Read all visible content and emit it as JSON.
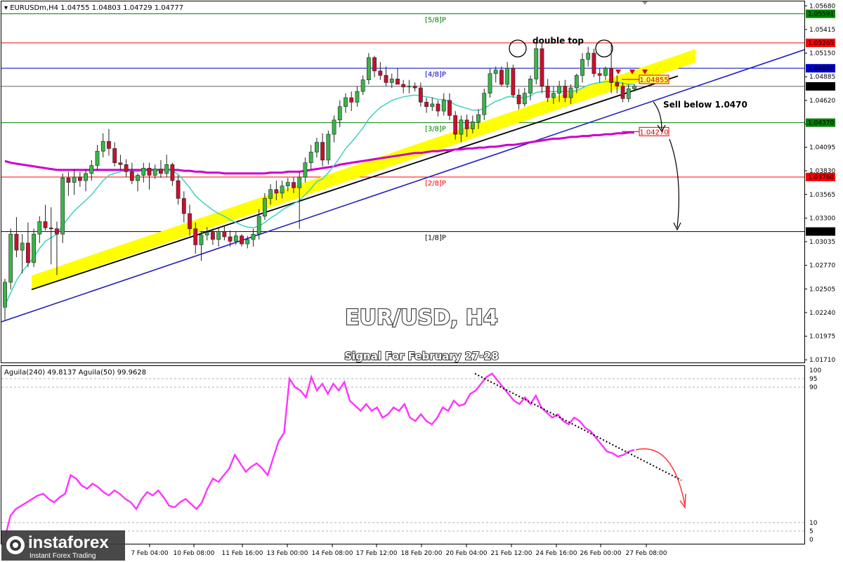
{
  "header": {
    "symbol": "EURUSDm,H4",
    "ohlc": "1.04755 1.04803 1.04729 1.04777"
  },
  "main_title": "EUR/USD, H4",
  "signal_title": "Signal For February  27-28",
  "annotations": {
    "double_top": "double top",
    "sell_below": "Sell below 1.0470"
  },
  "indicator_header": "Aguila(240) 49.8137  Aguila(50) 99.9628",
  "logo": {
    "name": "instaforex",
    "tagline": "Instant Forex Trading"
  },
  "colors": {
    "bull": "#39b54a",
    "bear": "#c8102e",
    "ema_short": "#40d0c0",
    "ema_long": "#cc00cc",
    "channel": "#ffff00",
    "trendline": "#000000",
    "blue_line": "#2020c0",
    "osc": "#ff33ff",
    "green_level": "#008000",
    "red_level": "#ff0000",
    "blue_level": "#0000cc"
  },
  "chart_data": [
    {
      "type": "candlestick",
      "title": "EUR/USD, H4",
      "price_axis_ticks": [
        "1.05680",
        "1.05415",
        "1.05150",
        "1.04885",
        "1.04620",
        "1.04355",
        "1.04095",
        "1.03830",
        "1.03565",
        "1.03300",
        "1.03035",
        "1.02770",
        "1.02505",
        "1.02240",
        "1.01975",
        "1.01710"
      ],
      "ylim": [
        1.0168,
        1.0573
      ],
      "time_labels": [
        "7 Feb 04:00",
        "10 Feb 08:00",
        "11 Feb 16:00",
        "13 Feb 00:00",
        "14 Feb 08:00",
        "17 Feb 12:00",
        "18 Feb 20:00",
        "20 Feb 04:00",
        "21 Feb 12:00",
        "24 Feb 16:00",
        "26 Feb 00:00",
        "27 Feb 08:00"
      ],
      "murrey_levels": [
        {
          "label": "[5/8]P",
          "price": 1.05591,
          "tag": "1.05591",
          "color": "#008000"
        },
        {
          "label": "",
          "price": 1.05265,
          "tag": "1.05265",
          "color": "#ff0000"
        },
        {
          "label": "[4/8]P",
          "price": 1.0498,
          "tag": "1.04980",
          "color": "#0000cc"
        },
        {
          "label": "[3/8]P",
          "price": 1.0437,
          "tag": "1.04370",
          "color": "#008000"
        },
        {
          "label": "[2/8]P",
          "price": 1.0376,
          "tag": "1.03760",
          "color": "#ff0000"
        },
        {
          "label": "[1/8]P",
          "price": 1.03149,
          "tag": "1.03149",
          "color": "#000000"
        }
      ],
      "current_price": "1.04777",
      "marked_levels": [
        {
          "price": 1.04855,
          "tag": "1.04855"
        },
        {
          "price": 1.0427,
          "tag": "1.04270"
        }
      ],
      "candles": [
        [
          1.023,
          1.0262,
          1.0216,
          1.0258
        ],
        [
          1.0258,
          1.0318,
          1.025,
          1.0312
        ],
        [
          1.0312,
          1.0331,
          1.0286,
          1.0294
        ],
        [
          1.0294,
          1.0312,
          1.0268,
          1.0302
        ],
        [
          1.0302,
          1.0325,
          1.0275,
          1.028
        ],
        [
          1.028,
          1.0318,
          1.0275,
          1.0312
        ],
        [
          1.0312,
          1.0332,
          1.0302,
          1.0326
        ],
        [
          1.0326,
          1.0345,
          1.0316,
          1.0319
        ],
        [
          1.0319,
          1.0342,
          1.0278,
          1.0318
        ],
        [
          1.0318,
          1.0326,
          1.0266,
          1.0312
        ],
        [
          1.0312,
          1.038,
          1.0302,
          1.0375
        ],
        [
          1.0375,
          1.0382,
          1.0355,
          1.037
        ],
        [
          1.037,
          1.0385,
          1.0356,
          1.0376
        ],
        [
          1.0376,
          1.0382,
          1.0365,
          1.0372
        ],
        [
          1.0372,
          1.0385,
          1.036,
          1.038
        ],
        [
          1.038,
          1.0395,
          1.0372,
          1.0389
        ],
        [
          1.0389,
          1.0412,
          1.0384,
          1.0405
        ],
        [
          1.0405,
          1.0425,
          1.0398,
          1.0416
        ],
        [
          1.0416,
          1.043,
          1.04,
          1.0408
        ],
        [
          1.0408,
          1.0415,
          1.0388,
          1.0392
        ],
        [
          1.0392,
          1.0401,
          1.0384,
          1.039
        ],
        [
          1.039,
          1.0396,
          1.0376,
          1.0382
        ],
        [
          1.0382,
          1.0392,
          1.0368,
          1.0372
        ],
        [
          1.0372,
          1.038,
          1.036,
          1.0378
        ],
        [
          1.0378,
          1.0392,
          1.037,
          1.0386
        ],
        [
          1.0386,
          1.0392,
          1.0362,
          1.0378
        ],
        [
          1.0378,
          1.039,
          1.0374,
          1.0385
        ],
        [
          1.0385,
          1.0395,
          1.0375,
          1.038
        ],
        [
          1.038,
          1.0401,
          1.0376,
          1.039
        ],
        [
          1.039,
          1.0392,
          1.0366,
          1.0372
        ],
        [
          1.0372,
          1.0378,
          1.0345,
          1.0352
        ],
        [
          1.0352,
          1.036,
          1.0325,
          1.0335
        ],
        [
          1.0335,
          1.0345,
          1.031,
          1.0318
        ],
        [
          1.0318,
          1.0325,
          1.029,
          1.03
        ],
        [
          1.03,
          1.0315,
          1.0282,
          1.0311
        ],
        [
          1.0311,
          1.032,
          1.0305,
          1.0314
        ],
        [
          1.0314,
          1.0318,
          1.03,
          1.0306
        ],
        [
          1.0306,
          1.032,
          1.0298,
          1.0315
        ],
        [
          1.0315,
          1.0322,
          1.0305,
          1.0309
        ],
        [
          1.0309,
          1.0316,
          1.0298,
          1.0304
        ],
        [
          1.0304,
          1.0315,
          1.03,
          1.031
        ],
        [
          1.031,
          1.0312,
          1.0298,
          1.0301
        ],
        [
          1.0301,
          1.031,
          1.0296,
          1.0306
        ],
        [
          1.0306,
          1.0318,
          1.0298,
          1.0312
        ],
        [
          1.0312,
          1.034,
          1.0306,
          1.0332
        ],
        [
          1.0332,
          1.0358,
          1.0328,
          1.0352
        ],
        [
          1.0352,
          1.0368,
          1.0345,
          1.0362
        ],
        [
          1.0362,
          1.0372,
          1.035,
          1.0358
        ],
        [
          1.0358,
          1.0372,
          1.0352,
          1.0366
        ],
        [
          1.0366,
          1.0375,
          1.036,
          1.037
        ],
        [
          1.037,
          1.0376,
          1.0358,
          1.0364
        ],
        [
          1.0364,
          1.0382,
          1.0318,
          1.0376
        ],
        [
          1.0376,
          1.0398,
          1.037,
          1.0392
        ],
        [
          1.0392,
          1.0412,
          1.0385,
          1.0404
        ],
        [
          1.0404,
          1.042,
          1.0398,
          1.0415
        ],
        [
          1.0415,
          1.0425,
          1.0388,
          1.0395
        ],
        [
          1.0395,
          1.0428,
          1.039,
          1.0424
        ],
        [
          1.0424,
          1.0445,
          1.0415,
          1.044
        ],
        [
          1.044,
          1.0462,
          1.0432,
          1.0455
        ],
        [
          1.0455,
          1.047,
          1.0448,
          1.0465
        ],
        [
          1.0465,
          1.0472,
          1.045,
          1.046
        ],
        [
          1.046,
          1.0478,
          1.0455,
          1.0472
        ],
        [
          1.0472,
          1.049,
          1.0468,
          1.0485
        ],
        [
          1.0485,
          1.0515,
          1.048,
          1.051
        ],
        [
          1.051,
          1.0512,
          1.0488,
          1.0495
        ],
        [
          1.0495,
          1.0505,
          1.0485,
          1.049
        ],
        [
          1.049,
          1.05,
          1.0478,
          1.0482
        ],
        [
          1.0482,
          1.0492,
          1.0476,
          1.0486
        ],
        [
          1.0486,
          1.0498,
          1.048,
          1.048
        ],
        [
          1.048,
          1.0485,
          1.047,
          1.0477
        ],
        [
          1.0477,
          1.0485,
          1.047,
          1.0478
        ],
        [
          1.0478,
          1.0482,
          1.0472,
          1.0476
        ],
        [
          1.0476,
          1.0482,
          1.0455,
          1.046
        ],
        [
          1.046,
          1.0465,
          1.0448,
          1.0455
        ],
        [
          1.0455,
          1.0465,
          1.045,
          1.0458
        ],
        [
          1.0458,
          1.0462,
          1.0444,
          1.045
        ],
        [
          1.045,
          1.047,
          1.0445,
          1.0462
        ],
        [
          1.0462,
          1.047,
          1.044,
          1.0445
        ],
        [
          1.0445,
          1.045,
          1.0418,
          1.0424
        ],
        [
          1.0424,
          1.0445,
          1.0415,
          1.044
        ],
        [
          1.044,
          1.0446,
          1.0421,
          1.043
        ],
        [
          1.043,
          1.0445,
          1.0425,
          1.0438
        ],
        [
          1.0438,
          1.0452,
          1.043,
          1.0446
        ],
        [
          1.0446,
          1.0475,
          1.044,
          1.047
        ],
        [
          1.047,
          1.0498,
          1.0465,
          1.0492
        ],
        [
          1.0492,
          1.05,
          1.0482,
          1.0496
        ],
        [
          1.0496,
          1.05,
          1.0478,
          1.048
        ],
        [
          1.048,
          1.0505,
          1.0476,
          1.0498
        ],
        [
          1.0498,
          1.0502,
          1.0465,
          1.0468
        ],
        [
          1.0468,
          1.0475,
          1.0452,
          1.0458
        ],
        [
          1.0458,
          1.0476,
          1.0455,
          1.047
        ],
        [
          1.047,
          1.049,
          1.0462,
          1.0486
        ],
        [
          1.0486,
          1.0528,
          1.048,
          1.052
        ],
        [
          1.052,
          1.0526,
          1.047,
          1.0478
        ],
        [
          1.0478,
          1.0486,
          1.046,
          1.0465
        ],
        [
          1.0465,
          1.0478,
          1.0458,
          1.047
        ],
        [
          1.047,
          1.0484,
          1.046,
          1.0478
        ],
        [
          1.0478,
          1.0485,
          1.046,
          1.0465
        ],
        [
          1.0465,
          1.048,
          1.0458,
          1.0476
        ],
        [
          1.0476,
          1.0492,
          1.047,
          1.049
        ],
        [
          1.049,
          1.0515,
          1.0482,
          1.0508
        ],
        [
          1.0508,
          1.0522,
          1.05,
          1.0515
        ],
        [
          1.0515,
          1.052,
          1.0488,
          1.0492
        ],
        [
          1.0492,
          1.0498,
          1.0482,
          1.049
        ],
        [
          1.049,
          1.05,
          1.0485,
          1.0498
        ],
        [
          1.0498,
          1.0525,
          1.047,
          1.0482
        ],
        [
          1.0482,
          1.049,
          1.047,
          1.0478
        ],
        [
          1.0478,
          1.0482,
          1.046,
          1.0464
        ],
        [
          1.0464,
          1.048,
          1.046,
          1.0475
        ],
        [
          1.0475,
          1.048,
          1.0472,
          1.0478
        ]
      ],
      "ema_short_values": [
        1.0232,
        1.0246,
        1.026,
        1.027,
        1.0278,
        1.0286,
        1.0296,
        1.0304,
        1.0308,
        1.0312,
        1.0322,
        1.033,
        1.0338,
        1.0344,
        1.035,
        1.0356,
        1.0364,
        1.0372,
        1.0378,
        1.038,
        1.0382,
        1.0383,
        1.0382,
        1.0382,
        1.0383,
        1.0383,
        1.0383,
        1.0383,
        1.0384,
        1.0383,
        1.0379,
        1.0372,
        1.0364,
        1.0355,
        1.0349,
        1.0344,
        1.0339,
        1.0335,
        1.0332,
        1.0328,
        1.0325,
        1.0322,
        1.032,
        1.0319,
        1.0321,
        1.0325,
        1.033,
        1.0334,
        1.0339,
        1.0343,
        1.0346,
        1.035,
        1.0356,
        1.0363,
        1.0371,
        1.0374,
        1.0381,
        1.0389,
        1.0398,
        1.0408,
        1.0415,
        1.0423,
        1.0431,
        1.0441,
        1.0448,
        1.0454,
        1.0458,
        1.0462,
        1.0464,
        1.0466,
        1.0467,
        1.0468,
        1.0467,
        1.0466,
        1.0465,
        1.0463,
        1.0463,
        1.0461,
        1.0457,
        1.0455,
        1.0453,
        1.0451,
        1.0451,
        1.0453,
        1.0457,
        1.0461,
        1.0463,
        1.0466,
        1.0466,
        1.0465,
        1.0465,
        1.0467,
        1.0471,
        1.0472,
        1.0472,
        1.0472,
        1.0472,
        1.0472,
        1.0472,
        1.0473,
        1.0476,
        1.0479,
        1.0481,
        1.0482,
        1.0483,
        1.0483,
        1.0483,
        1.0481,
        1.048,
        1.048
      ],
      "ema_long_values": [
        1.0394,
        1.0392,
        1.0391,
        1.039,
        1.0389,
        1.0388,
        1.0387,
        1.0386,
        1.0385,
        1.0384,
        1.0384,
        1.0384,
        1.0384,
        1.0384,
        1.0384,
        1.0384,
        1.0384,
        1.0384,
        1.0384,
        1.0384,
        1.0384,
        1.0384,
        1.0384,
        1.0384,
        1.0384,
        1.0384,
        1.0384,
        1.0384,
        1.0384,
        1.0384,
        1.0384,
        1.0383,
        1.0383,
        1.0382,
        1.0382,
        1.0381,
        1.0381,
        1.0381,
        1.038,
        1.038,
        1.038,
        1.038,
        1.038,
        1.038,
        1.038,
        1.038,
        1.0381,
        1.0381,
        1.0381,
        1.0382,
        1.0382,
        1.0382,
        1.0383,
        1.0384,
        1.0385,
        1.0386,
        1.0387,
        1.0388,
        1.039,
        1.0391,
        1.0392,
        1.0393,
        1.0394,
        1.0395,
        1.0396,
        1.0397,
        1.0398,
        1.0399,
        1.04,
        1.0401,
        1.0402,
        1.0403,
        1.0403,
        1.0404,
        1.0405,
        1.0405,
        1.0406,
        1.0406,
        1.0407,
        1.0407,
        1.0408,
        1.0408,
        1.0409,
        1.0409,
        1.041,
        1.041,
        1.0411,
        1.0412,
        1.0412,
        1.0413,
        1.0414,
        1.0415,
        1.0416,
        1.0417,
        1.0418,
        1.0419,
        1.0419,
        1.042,
        1.0421,
        1.0421,
        1.0422,
        1.0422,
        1.0423,
        1.0423,
        1.0424,
        1.0424,
        1.0425,
        1.0425,
        1.0426,
        1.0426
      ]
    },
    {
      "type": "line",
      "title": "Aguila(240) 49.8137  Aguila(50) 99.9628",
      "ylim": [
        0,
        100
      ],
      "reference_levels": [
        100,
        95,
        90,
        10,
        5,
        0
      ],
      "series": [
        {
          "values": [
            1,
            14,
            18,
            20,
            22,
            24,
            26,
            27,
            24,
            22,
            25,
            27,
            38,
            36,
            32,
            30,
            33,
            31,
            28,
            26,
            29,
            27,
            24,
            22,
            18,
            24,
            28,
            26,
            29,
            25,
            20,
            19,
            22,
            24,
            21,
            18,
            22,
            30,
            36,
            34,
            38,
            42,
            50,
            45,
            40,
            43,
            45,
            42,
            38,
            48,
            58,
            63,
            95,
            90,
            88,
            84,
            96,
            88,
            92,
            86,
            92,
            88,
            93,
            82,
            79,
            76,
            80,
            76,
            78,
            72,
            74,
            78,
            76,
            80,
            72,
            70,
            74,
            70,
            68,
            72,
            78,
            76,
            82,
            79,
            80,
            86,
            88,
            92,
            96,
            98,
            94,
            90,
            86,
            82,
            80,
            84,
            80,
            85,
            78,
            75,
            72,
            74,
            70,
            68,
            72,
            70,
            66,
            64,
            60,
            56,
            52,
            51,
            49,
            50,
            52,
            53
          ]
        }
      ]
    }
  ]
}
